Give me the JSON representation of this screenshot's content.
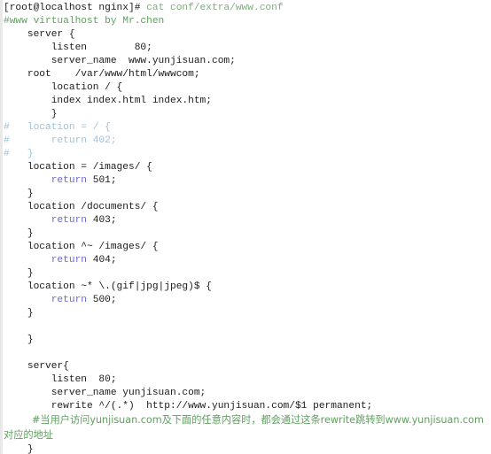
{
  "terminal": {
    "title": "nginx www.conf terminal output",
    "colors": {
      "background": "#ffffff",
      "default_text": "#1b1b1b",
      "command_green": "#7fae7f",
      "comment_green": "#5fa05f",
      "hash_comment_blue": "#9fc3da",
      "keyword_blue": "#6a6ad6",
      "left_edge": "#e9e9e9"
    },
    "prompt": {
      "user": "root",
      "host": "localhost",
      "cwd": "nginx",
      "text": "[root@localhost nginx]#",
      "command": " cat conf/extra/www.conf"
    },
    "lines": [
      {
        "id": "line-prompt",
        "type": "prompt",
        "segments": [
          {
            "text": "[root@localhost nginx]#",
            "color": "default"
          },
          {
            "text": " cat conf/extra/www.conf",
            "color": "cmd"
          }
        ]
      },
      {
        "id": "line-file-comment",
        "type": "comment",
        "segments": [
          {
            "text": "#www virtualhost by Mr.chen",
            "color": "comment"
          }
        ]
      },
      {
        "id": "line-server-open",
        "type": "code",
        "segments": [
          {
            "text": "    server {",
            "color": "default"
          }
        ]
      },
      {
        "id": "line-listen-80",
        "type": "code",
        "segments": [
          {
            "text": "        listen        80;",
            "color": "default"
          }
        ]
      },
      {
        "id": "line-server-name-www",
        "type": "code",
        "segments": [
          {
            "text": "        server_name  www.yunjisuan.com;",
            "color": "default"
          }
        ]
      },
      {
        "id": "line-root",
        "type": "code",
        "segments": [
          {
            "text": "    root    /var/www/html/wwwcom;",
            "color": "default"
          }
        ]
      },
      {
        "id": "line-location-root-open",
        "type": "code",
        "segments": [
          {
            "text": "        location / {",
            "color": "default"
          }
        ]
      },
      {
        "id": "line-index",
        "type": "code",
        "segments": [
          {
            "text": "        index index.html index.htm;",
            "color": "default"
          }
        ]
      },
      {
        "id": "line-location-root-close",
        "type": "code",
        "segments": [
          {
            "text": "        }",
            "color": "default"
          }
        ]
      },
      {
        "id": "line-commented-location-eq",
        "type": "commented-code",
        "segments": [
          {
            "text": "#   location = / {",
            "color": "hashcom"
          }
        ]
      },
      {
        "id": "line-commented-return-402",
        "type": "commented-code",
        "segments": [
          {
            "text": "#       return 402;",
            "color": "hashcom"
          }
        ]
      },
      {
        "id": "line-commented-close",
        "type": "commented-code",
        "segments": [
          {
            "text": "#   }",
            "color": "hashcom"
          }
        ]
      },
      {
        "id": "line-location-images-eq-open",
        "type": "code",
        "segments": [
          {
            "text": "    location = /images/ {",
            "color": "default"
          }
        ]
      },
      {
        "id": "line-return-501",
        "type": "code",
        "segments": [
          {
            "text": "        ",
            "color": "default"
          },
          {
            "text": "return",
            "color": "keyword"
          },
          {
            "text": " 501;",
            "color": "default"
          }
        ]
      },
      {
        "id": "line-close-images-eq",
        "type": "code",
        "segments": [
          {
            "text": "    }",
            "color": "default"
          }
        ]
      },
      {
        "id": "line-location-documents-open",
        "type": "code",
        "segments": [
          {
            "text": "    location /documents/ {",
            "color": "default"
          }
        ]
      },
      {
        "id": "line-return-403",
        "type": "code",
        "segments": [
          {
            "text": "        ",
            "color": "default"
          },
          {
            "text": "return",
            "color": "keyword"
          },
          {
            "text": " 403;",
            "color": "default"
          }
        ]
      },
      {
        "id": "line-close-documents",
        "type": "code",
        "segments": [
          {
            "text": "    }",
            "color": "default"
          }
        ]
      },
      {
        "id": "line-location-images-prefix-open",
        "type": "code",
        "segments": [
          {
            "text": "    location ^~ /images/ {",
            "color": "default"
          }
        ]
      },
      {
        "id": "line-return-404",
        "type": "code",
        "segments": [
          {
            "text": "        ",
            "color": "default"
          },
          {
            "text": "return",
            "color": "keyword"
          },
          {
            "text": " 404;",
            "color": "default"
          }
        ]
      },
      {
        "id": "line-close-images-prefix",
        "type": "code",
        "segments": [
          {
            "text": "    }",
            "color": "default"
          }
        ]
      },
      {
        "id": "line-location-regex-open",
        "type": "code",
        "segments": [
          {
            "text": "    location ~* \\.(gif|jpg|jpeg)$ {",
            "color": "default"
          }
        ]
      },
      {
        "id": "line-return-500",
        "type": "code",
        "segments": [
          {
            "text": "        ",
            "color": "default"
          },
          {
            "text": "return",
            "color": "keyword"
          },
          {
            "text": " 500;",
            "color": "default"
          }
        ]
      },
      {
        "id": "line-close-regex",
        "type": "code",
        "segments": [
          {
            "text": "    }",
            "color": "default"
          }
        ]
      },
      {
        "id": "line-blank-1",
        "type": "blank",
        "segments": [
          {
            "text": "",
            "color": "default"
          }
        ]
      },
      {
        "id": "line-close-server-1",
        "type": "code",
        "segments": [
          {
            "text": "    }",
            "color": "default"
          }
        ]
      },
      {
        "id": "line-blank-2",
        "type": "blank",
        "segments": [
          {
            "text": "",
            "color": "default"
          }
        ]
      },
      {
        "id": "line-server2-open",
        "type": "code",
        "segments": [
          {
            "text": "    server{",
            "color": "default"
          }
        ]
      },
      {
        "id": "line-listen-80-b",
        "type": "code",
        "segments": [
          {
            "text": "        listen  80;",
            "color": "default"
          }
        ]
      },
      {
        "id": "line-server-name-bare",
        "type": "code",
        "segments": [
          {
            "text": "        server_name yunjisuan.com;",
            "color": "default"
          }
        ]
      },
      {
        "id": "line-rewrite",
        "type": "code",
        "segments": [
          {
            "text": "        rewrite ^/(.*)  http://www.yunjisuan.com/$1 permanent;",
            "color": "default"
          }
        ]
      },
      {
        "id": "line-chinese-comment",
        "type": "comment-wrap",
        "segments": [
          {
            "text": "         #当用户访问yunjisuan.com及下面的任意内容时，都会通过这条rewrite跳转到www.yunjisuan.com对应的地址",
            "color": "comment"
          }
        ]
      },
      {
        "id": "line-close-server-2",
        "type": "code",
        "segments": [
          {
            "text": "    }",
            "color": "default"
          }
        ]
      }
    ]
  }
}
